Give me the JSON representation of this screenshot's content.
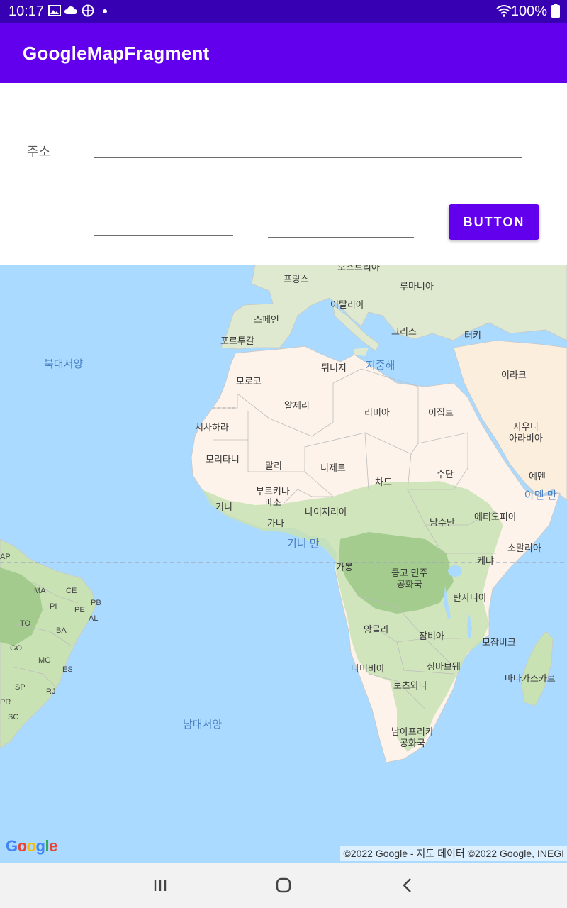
{
  "status_bar": {
    "time": "10:17",
    "battery": "100%",
    "notification_icons": [
      "image-icon",
      "cloud-icon",
      "basketball-icon",
      "dot-icon"
    ],
    "system_icons": [
      "wifi-icon",
      "battery-icon"
    ]
  },
  "app_bar": {
    "title": "GoogleMapFragment"
  },
  "form": {
    "address_label": "주소",
    "address_value": "",
    "field1_value": "",
    "field2_value": "",
    "button_label": "BUTTON"
  },
  "map": {
    "countries": [
      "프랑스",
      "오스트리아",
      "루마니아",
      "스페인",
      "이탈리아",
      "포르투갈",
      "그리스",
      "터키",
      "튀니지",
      "모로코",
      "이라크",
      "알제리",
      "리비아",
      "이집트",
      "서사하라",
      "사우디\n아라비아",
      "모리타니",
      "말리",
      "니제르",
      "차드",
      "수단",
      "예멘",
      "부르키나\n파소",
      "기니",
      "나이지리아",
      "가나",
      "남수단",
      "에티오피아",
      "소말리아",
      "가봉",
      "콩고 민주\n공화국",
      "케냐",
      "탄자니아",
      "앙골라",
      "잠비아",
      "모잠비크",
      "나미비아",
      "짐바브웨",
      "보츠와나",
      "마다가스카르",
      "남아프리카\n공화국"
    ],
    "seas": [
      "북대서양",
      "지중해",
      "아덴 만",
      "기니 만",
      "남대서양"
    ],
    "states": [
      "AP",
      "MA",
      "CE",
      "PI",
      "PB",
      "PE",
      "TO",
      "AL",
      "BA",
      "GO",
      "MG",
      "ES",
      "SP",
      "RJ",
      "PR",
      "SC"
    ],
    "logo": "Google",
    "copyright": "©2022 Google - 지도 데이터 ©2022 Google, INEGI"
  },
  "nav_bar": {
    "buttons": [
      "recents-icon",
      "home-icon",
      "back-icon"
    ]
  },
  "colors": {
    "status_bar": "#3700b3",
    "app_bar": "#6200ee",
    "button": "#6200ee",
    "water": "#aadaff",
    "desert": "#fdf3ea",
    "vegetation": "#b5d7a6"
  }
}
